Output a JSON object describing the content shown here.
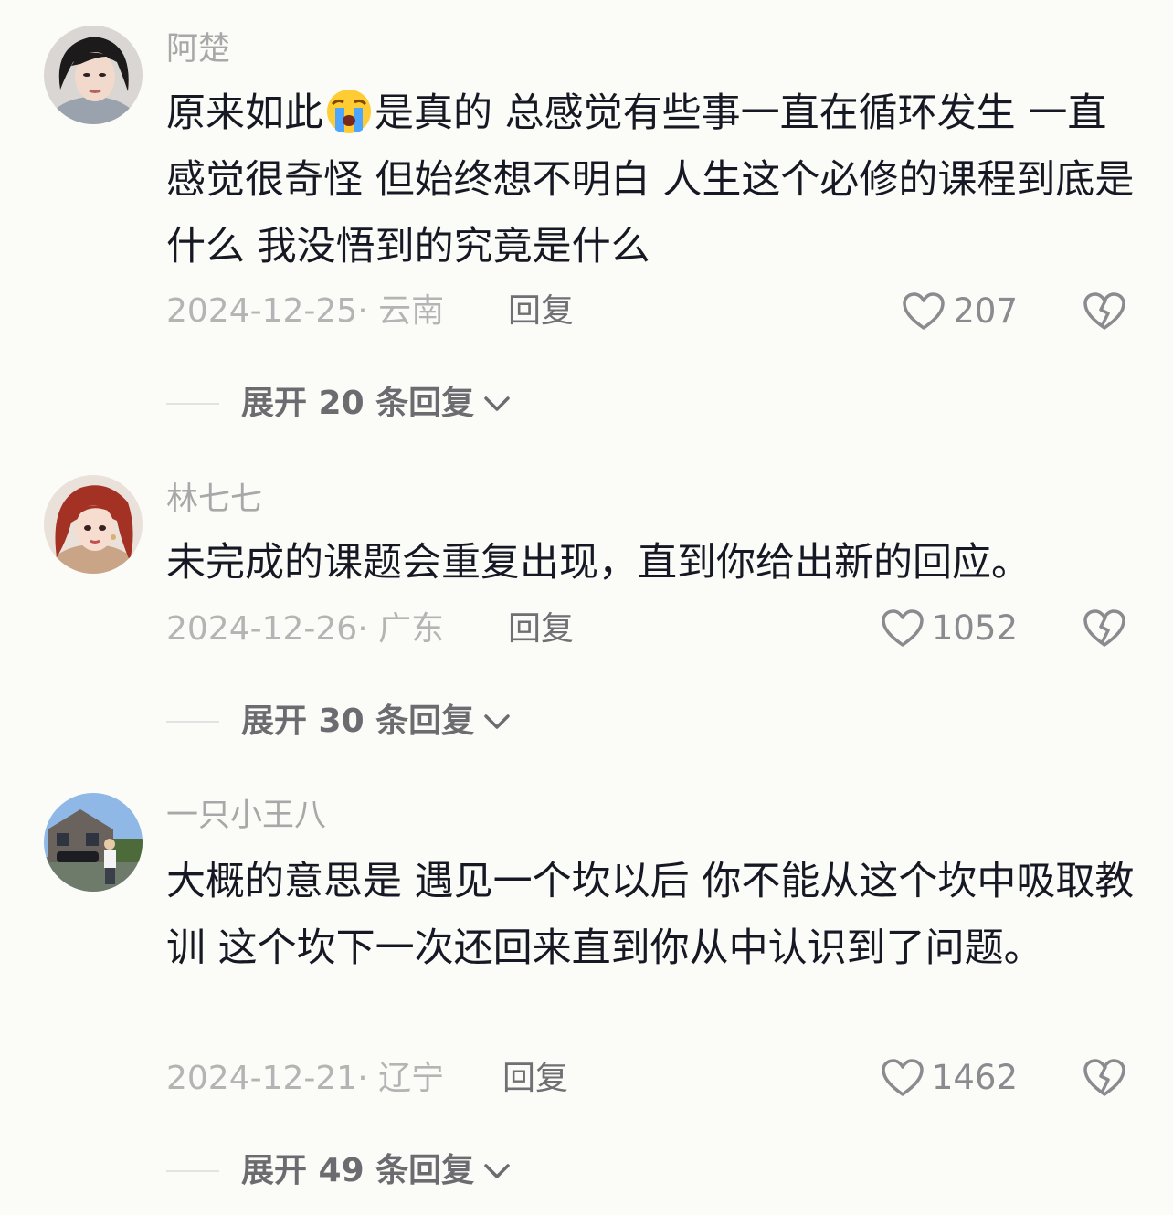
{
  "comments": [
    {
      "username": "阿楚",
      "text_before": "原来如此",
      "emoji": "crying-face-emoji",
      "text_after": "是真的 总感觉有些事一直在循环发生  一直感觉很奇怪  但始终想不明白 人生这个必修的课程到底是什么  我没悟到的究竟是什么",
      "date": "2024-12-25",
      "location": "云南",
      "reply_label": "回复",
      "likes": "207",
      "expand_label": "展开 20 条回复"
    },
    {
      "username": "林七七",
      "text": "未完成的课题会重复出现，直到你给出新的回应。",
      "date": "2024-12-26",
      "location": "广东",
      "reply_label": "回复",
      "likes": "1052",
      "expand_label": "展开 30 条回复"
    },
    {
      "username": "一只小王八",
      "text": "大概的意思是 遇见一个坎以后 你不能从这个坎中吸取教训 这个坎下一次还回来直到你从中认识到了问题。",
      "date": "2024-12-21",
      "location": "辽宁",
      "reply_label": "回复",
      "likes": "1462",
      "expand_label": "展开 49 条回复"
    }
  ],
  "meta_separator": "· ",
  "icons": {
    "like": "heart-outline-icon",
    "dislike": "broken-heart-icon",
    "expand": "chevron-down-icon"
  }
}
